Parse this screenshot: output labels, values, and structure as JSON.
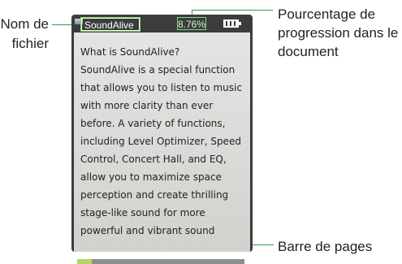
{
  "callouts": {
    "filename_label_line1": "Nom de",
    "filename_label_line2": "fichier",
    "progress_label_line1": "Pourcentage de",
    "progress_label_line2": "progression dans le",
    "progress_label_line3": "document",
    "pagebar_label": "Barre de pages"
  },
  "device": {
    "filename": "SoundAlive",
    "percent": "8.76%",
    "progress_fraction": 0.0876,
    "battery_icon": "battery-icon",
    "document_text": "What is SoundAlive?\nSoundAlive is a special function\nthat allows you to listen to music\nwith more clarity than ever\nbefore. A variety of functions,\nincluding Level Optimizer, Speed\nControl, Concert Hall, and EQ,\nallow you to maximize space\nperception and create thrilling\nstage-like sound for more\npowerful and vibrant sound"
  },
  "colors": {
    "callout_line": "#3a9a45",
    "progress_fill": "#b3d56b"
  }
}
